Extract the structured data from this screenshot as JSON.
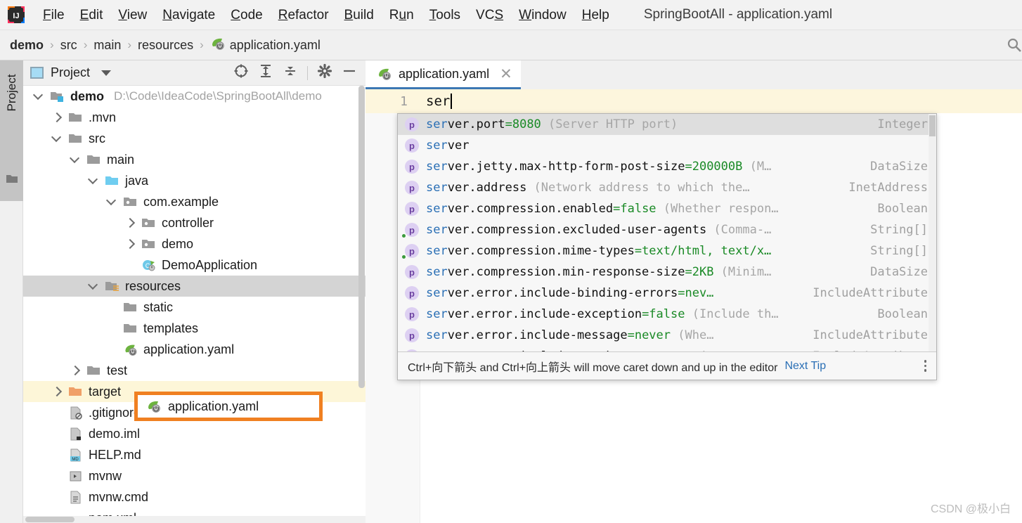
{
  "window": {
    "title": "SpringBootAll - application.yaml",
    "logo_icon": "intellij-idea-logo"
  },
  "menubar": {
    "items": [
      {
        "label": "File",
        "mnemonic": "F"
      },
      {
        "label": "Edit",
        "mnemonic": "E"
      },
      {
        "label": "View",
        "mnemonic": "V"
      },
      {
        "label": "Navigate",
        "mnemonic": "N"
      },
      {
        "label": "Code",
        "mnemonic": "C"
      },
      {
        "label": "Refactor",
        "mnemonic": "R"
      },
      {
        "label": "Build",
        "mnemonic": "B"
      },
      {
        "label": "Run",
        "mnemonic": "u"
      },
      {
        "label": "Tools",
        "mnemonic": "T"
      },
      {
        "label": "VCS",
        "mnemonic": "S"
      },
      {
        "label": "Window",
        "mnemonic": "W"
      },
      {
        "label": "Help",
        "mnemonic": "H"
      }
    ]
  },
  "breadcrumb": {
    "separator": "›",
    "items": [
      "demo",
      "src",
      "main",
      "resources",
      "application.yaml"
    ],
    "file_icon": "spring-yaml-icon",
    "right_icon": "search-everywhere-icon"
  },
  "toolstrip": {
    "label": "Project",
    "icon": "folder-icon"
  },
  "project_panel": {
    "title": "Project",
    "dropdown_icon": "chevron-down-icon",
    "tools": [
      {
        "name": "select-opened-file-icon",
        "label": "Select Opened File"
      },
      {
        "name": "expand-all-icon",
        "label": "Expand All"
      },
      {
        "name": "collapse-all-icon",
        "label": "Collapse All"
      },
      {
        "name": "gear-icon",
        "label": "Settings"
      },
      {
        "name": "hide-icon",
        "label": "Hide"
      }
    ],
    "tree": [
      {
        "label": "demo",
        "path": "D:\\Code\\IdeaCode\\SpringBootAll\\demo",
        "depth": 0,
        "arrow": "down",
        "icon": "module-icon",
        "bold": true,
        "state": "normal"
      },
      {
        "label": ".mvn",
        "depth": 1,
        "arrow": "right",
        "icon": "folder-icon",
        "state": "normal"
      },
      {
        "label": "src",
        "depth": 1,
        "arrow": "down",
        "icon": "folder-icon",
        "state": "normal"
      },
      {
        "label": "main",
        "depth": 2,
        "arrow": "down",
        "icon": "folder-icon",
        "state": "normal"
      },
      {
        "label": "java",
        "depth": 3,
        "arrow": "down",
        "icon": "source-folder-icon",
        "state": "normal"
      },
      {
        "label": "com.example",
        "depth": 4,
        "arrow": "down",
        "icon": "package-icon",
        "state": "normal"
      },
      {
        "label": "controller",
        "depth": 5,
        "arrow": "right",
        "icon": "package-icon",
        "state": "normal"
      },
      {
        "label": "demo",
        "depth": 5,
        "arrow": "right",
        "icon": "package-icon",
        "state": "normal"
      },
      {
        "label": "DemoApplication",
        "depth": 5,
        "arrow": "none",
        "icon": "spring-class-icon",
        "state": "normal"
      },
      {
        "label": "resources",
        "depth": 3,
        "arrow": "down",
        "icon": "resources-folder-icon",
        "state": "selected"
      },
      {
        "label": "static",
        "depth": 4,
        "arrow": "none",
        "icon": "folder-icon",
        "state": "normal"
      },
      {
        "label": "templates",
        "depth": 4,
        "arrow": "none",
        "icon": "folder-icon",
        "state": "normal"
      },
      {
        "label": "application.yaml",
        "depth": 4,
        "arrow": "none",
        "icon": "spring-yaml-icon",
        "state": "highlighted"
      },
      {
        "label": "test",
        "depth": 2,
        "arrow": "right",
        "icon": "folder-icon",
        "state": "normal"
      },
      {
        "label": "target",
        "depth": 1,
        "arrow": "right",
        "icon": "excluded-folder-icon",
        "state": "warning"
      },
      {
        "label": ".gitignore",
        "depth": 1,
        "arrow": "none",
        "icon": "gitignore-file-icon",
        "state": "normal"
      },
      {
        "label": "demo.iml",
        "depth": 1,
        "arrow": "none",
        "icon": "iml-file-icon",
        "state": "normal"
      },
      {
        "label": "HELP.md",
        "depth": 1,
        "arrow": "none",
        "icon": "markdown-file-icon",
        "state": "normal"
      },
      {
        "label": "mvnw",
        "depth": 1,
        "arrow": "none",
        "icon": "script-file-icon",
        "state": "normal"
      },
      {
        "label": "mvnw.cmd",
        "depth": 1,
        "arrow": "none",
        "icon": "cmd-file-icon",
        "state": "normal"
      },
      {
        "label": "pom.xml",
        "depth": 1,
        "arrow": "none",
        "icon": "maven-file-icon",
        "state": "normal"
      }
    ],
    "highlight_color": "#f08021"
  },
  "editor": {
    "tab": {
      "label": "application.yaml",
      "icon": "spring-yaml-icon",
      "close_icon": "close-icon"
    },
    "line_number": "1",
    "line_text": "ser"
  },
  "completion_popup": {
    "items": [
      {
        "prefix": "ser",
        "name": "ver.port",
        "value": "=8080",
        "doc": "(Server HTTP port)",
        "type": "Integer",
        "selected": true,
        "deprecated_dot": false
      },
      {
        "prefix": "ser",
        "name": "ver",
        "value": "",
        "doc": "",
        "type": "",
        "selected": false,
        "deprecated_dot": false
      },
      {
        "prefix": "ser",
        "name": "ver.jetty.max-http-form-post-size",
        "value": "=200000B",
        "doc": "(M…",
        "type": "DataSize",
        "selected": false,
        "deprecated_dot": false
      },
      {
        "prefix": "ser",
        "name": "ver.address",
        "value": "",
        "doc": "(Network address to which the…",
        "type": "InetAddress",
        "selected": false,
        "deprecated_dot": false
      },
      {
        "prefix": "ser",
        "name": "ver.compression.enabled",
        "value": "=false",
        "doc": "(Whether respon…",
        "type": "Boolean",
        "selected": false,
        "deprecated_dot": false
      },
      {
        "prefix": "ser",
        "name": "ver.compression.excluded-user-agents",
        "value": "",
        "doc": "(Comma-…",
        "type": "String[]",
        "selected": false,
        "deprecated_dot": true
      },
      {
        "prefix": "ser",
        "name": "ver.compression.mime-types",
        "value": "=text/html, text/x…",
        "doc": "",
        "type": "String[]",
        "selected": false,
        "deprecated_dot": true
      },
      {
        "prefix": "ser",
        "name": "ver.compression.min-response-size",
        "value": "=2KB",
        "doc": "(Minim…",
        "type": "DataSize",
        "selected": false,
        "deprecated_dot": false
      },
      {
        "prefix": "ser",
        "name": "ver.error.include-binding-errors",
        "value": "=nev…",
        "doc": "",
        "type": "IncludeAttribute",
        "selected": false,
        "deprecated_dot": false
      },
      {
        "prefix": "ser",
        "name": "ver.error.include-exception",
        "value": "=false",
        "doc": "(Include th…",
        "type": "Boolean",
        "selected": false,
        "deprecated_dot": false
      },
      {
        "prefix": "ser",
        "name": "ver.error.include-message",
        "value": "=never",
        "doc": "(Whe…",
        "type": "IncludeAttribute",
        "selected": false,
        "deprecated_dot": false
      },
      {
        "prefix": "ser",
        "name": "ver.error.include-stacktrace",
        "value": "=never",
        "doc": "(",
        "type": "IncludeAttribute",
        "selected": false,
        "deprecated_dot": false
      }
    ],
    "badge_letter": "p",
    "footer_text": "Ctrl+向下箭头 and Ctrl+向上箭头 will move caret down and up in the editor",
    "footer_link": "Next Tip",
    "footer_menu_icon": "more-vertical-icon",
    "match_color": "#2a6fb5",
    "value_color": "#1a8a26"
  },
  "watermark": {
    "text": "CSDN @极小白"
  }
}
